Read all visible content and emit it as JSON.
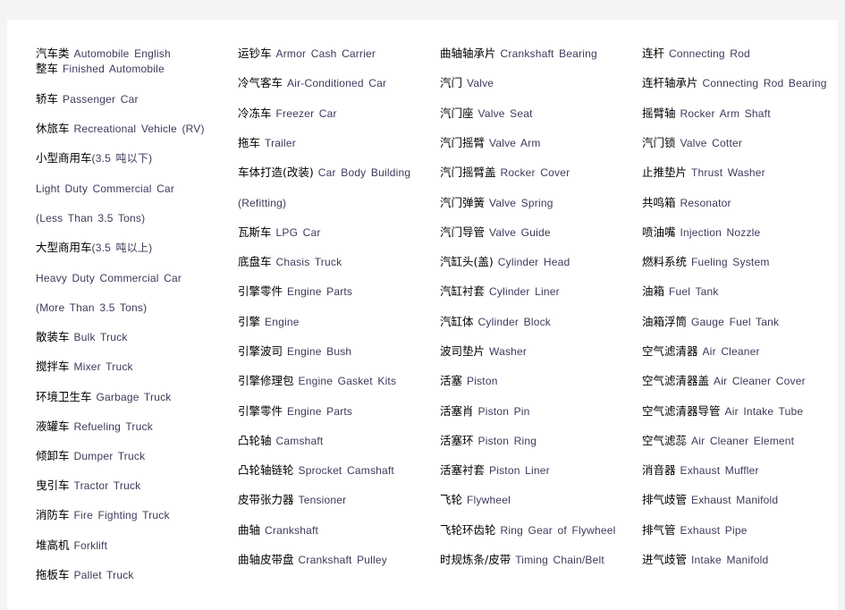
{
  "columns": [
    [
      {
        "cn": "汽车类",
        "en": "Automobile English"
      },
      {
        "cn": "整车",
        "en": "Finished Automobile"
      },
      {
        "cn": "轿车",
        "en": "Passenger Car"
      },
      {
        "cn": "休旅车",
        "en": "Recreational Vehicle (RV)"
      },
      {
        "cn": "小型商用车",
        "en": "(3.5 吨以下)"
      },
      {
        "cn": "",
        "en": "Light Duty Commercial Car"
      },
      {
        "cn": "",
        "en": "(Less Than 3.5 Tons)"
      },
      {
        "cn": "大型商用车",
        "en": "(3.5 吨以上)"
      },
      {
        "cn": "",
        "en": "Heavy Duty Commercial Car"
      },
      {
        "cn": "",
        "en": "(More Than 3.5 Tons)"
      },
      {
        "cn": "散装车",
        "en": "Bulk Truck"
      },
      {
        "cn": "搅拌车",
        "en": "Mixer Truck"
      },
      {
        "cn": "环境卫生车",
        "en": "Garbage Truck"
      },
      {
        "cn": "液罐车",
        "en": "Refueling Truck"
      },
      {
        "cn": "倾卸车",
        "en": "Dumper Truck"
      },
      {
        "cn": "曳引车",
        "en": "Tractor Truck"
      },
      {
        "cn": "消防车",
        "en": "Fire Fighting Truck"
      },
      {
        "cn": "堆高机",
        "en": "Forklift"
      },
      {
        "cn": "拖板车",
        "en": "Pallet Truck"
      }
    ],
    [
      {
        "cn": "运钞车",
        "en": "Armor Cash Carrier"
      },
      {
        "cn": "冷气客车",
        "en": "Air-Conditioned Car"
      },
      {
        "cn": "冷冻车",
        "en": "Freezer Car"
      },
      {
        "cn": "拖车",
        "en": "Trailer"
      },
      {
        "cn": "车体打造(改装)",
        "en": "Car Body Building"
      },
      {
        "cn": "",
        "en": "(Refitting)"
      },
      {
        "cn": "瓦斯车",
        "en": "LPG Car"
      },
      {
        "cn": "底盘车",
        "en": "Chasis Truck"
      },
      {
        "cn": "引擎零件",
        "en": "Engine Parts"
      },
      {
        "cn": "引擎",
        "en": "Engine"
      },
      {
        "cn": "引擎波司",
        "en": "Engine Bush"
      },
      {
        "cn": "引擎修理包",
        "en": "Engine Gasket Kits"
      },
      {
        "cn": "引擎零件",
        "en": "Engine Parts"
      },
      {
        "cn": "凸轮轴",
        "en": "Camshaft"
      },
      {
        "cn": "凸轮轴链轮",
        "en": "Sprocket Camshaft"
      },
      {
        "cn": "皮带张力器",
        "en": "Tensioner"
      },
      {
        "cn": "曲轴",
        "en": "Crankshaft"
      },
      {
        "cn": "曲轴皮带盘",
        "en": "Crankshaft Pulley"
      }
    ],
    [
      {
        "cn": "曲轴轴承片",
        "en": "Crankshaft Bearing"
      },
      {
        "cn": "汽门",
        "en": "Valve"
      },
      {
        "cn": "汽门座",
        "en": "Valve Seat"
      },
      {
        "cn": "汽门摇臂",
        "en": "Valve Arm"
      },
      {
        "cn": "汽门摇臂盖",
        "en": "Rocker Cover"
      },
      {
        "cn": "汽门弹簧",
        "en": "Valve Spring"
      },
      {
        "cn": "汽门导管",
        "en": "Valve Guide"
      },
      {
        "cn": "汽缸头(盖)",
        "en": "Cylinder Head"
      },
      {
        "cn": "汽缸衬套",
        "en": "Cylinder Liner"
      },
      {
        "cn": "汽缸体",
        "en": "Cylinder Block"
      },
      {
        "cn": "波司垫片",
        "en": "Washer"
      },
      {
        "cn": "活塞",
        "en": "Piston"
      },
      {
        "cn": "活塞肖",
        "en": "Piston Pin"
      },
      {
        "cn": "活塞环",
        "en": "Piston Ring"
      },
      {
        "cn": "活塞衬套",
        "en": "Piston Liner"
      },
      {
        "cn": "飞轮",
        "en": "Flywheel"
      },
      {
        "cn": "飞轮环齿轮",
        "en": "Ring Gear of Flywheel"
      },
      {
        "cn": "时规炼条/皮带",
        "en": "Timing Chain/Belt"
      }
    ],
    [
      {
        "cn": "连杆",
        "en": "Connecting Rod"
      },
      {
        "cn": "连杆轴承片",
        "en": "Connecting Rod Bearing"
      },
      {
        "cn": "摇臂轴",
        "en": "Rocker Arm Shaft"
      },
      {
        "cn": "汽门锁",
        "en": "Valve Cotter"
      },
      {
        "cn": "止推垫片",
        "en": "Thrust Washer"
      },
      {
        "cn": "共鸣箱",
        "en": "Resonator"
      },
      {
        "cn": "喷油嘴",
        "en": "Injection Nozzle"
      },
      {
        "cn": "燃料系统",
        "en": "Fueling System"
      },
      {
        "cn": "油箱",
        "en": "Fuel Tank"
      },
      {
        "cn": "油箱浮筒",
        "en": "Gauge Fuel Tank"
      },
      {
        "cn": "空气滤清器",
        "en": "Air Cleaner"
      },
      {
        "cn": "空气滤清器盖",
        "en": "Air Cleaner Cover"
      },
      {
        "cn": "空气滤清器导管",
        "en": "Air Intake Tube"
      },
      {
        "cn": "空气滤蕊",
        "en": "Air Cleaner Element"
      },
      {
        "cn": "消音器",
        "en": "Exhaust Muffler"
      },
      {
        "cn": "排气歧管",
        "en": "Exhaust Manifold"
      },
      {
        "cn": "排气管",
        "en": "Exhaust Pipe"
      },
      {
        "cn": "进气歧管",
        "en": "Intake Manifold"
      }
    ]
  ]
}
